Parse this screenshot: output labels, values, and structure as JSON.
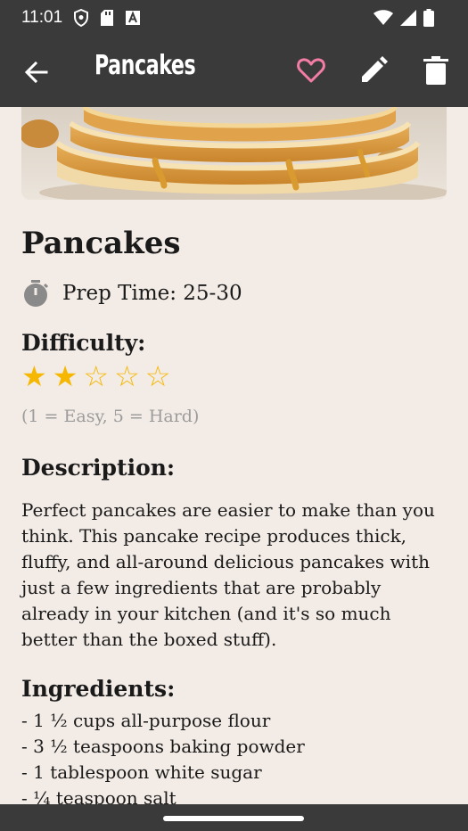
{
  "status_bar": {
    "time": "11:01",
    "left_icons": [
      "shield-icon",
      "sd-card-icon",
      "a-box-icon"
    ],
    "right_icons": [
      "wifi-icon",
      "signal-icon",
      "battery-icon"
    ]
  },
  "app_bar": {
    "title": "Pancakes",
    "icons": [
      "back-arrow-icon",
      "heart-outline-icon",
      "pencil-icon",
      "trash-icon"
    ],
    "accent_heart": "#f47da6"
  },
  "hero": {
    "description": "pancake-stack-photo"
  },
  "recipe": {
    "title": "Pancakes",
    "prep_time": "Prep Time: 25-30",
    "difficulty_heading": "Difficulty:",
    "difficulty_rating": 2,
    "difficulty_max": 5,
    "difficulty_legend": "(1 = Easy, 5 = Hard)",
    "description_heading": "Description:",
    "description": "Perfect pancakes are easier to make than you think. This pancake recipe produces thick, fluffy, and all-around delicious pancakes with just a few ingredients that are probably already in your kitchen (and it's so much better than the boxed stuff).",
    "ingredients_heading": "Ingredients:",
    "ingredients": [
      "- 1 ½ cups all-purpose flour",
      "- 3 ½ teaspoons baking powder",
      "- 1 tablespoon white sugar",
      "- ¼ teaspoon salt"
    ]
  },
  "colors": {
    "bar": "#3a3a3a",
    "background": "#f3ebe5",
    "star": "#f5b700",
    "muted": "#9c9c9c"
  }
}
